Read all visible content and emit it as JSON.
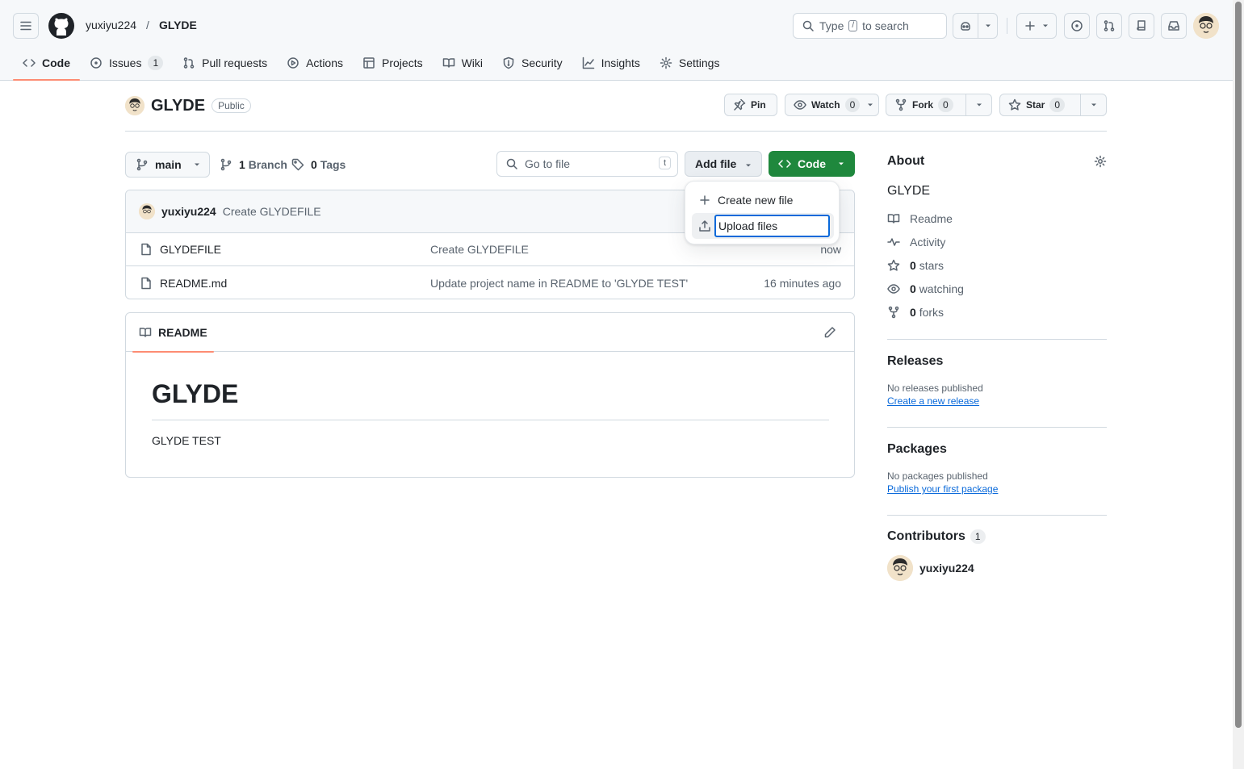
{
  "header": {
    "owner": "yuxiyu224",
    "separator": "/",
    "repo": "GLYDE",
    "search": {
      "prefix": "Type",
      "key": "/",
      "suffix": "to search"
    }
  },
  "tabs": [
    {
      "label": "Code",
      "icon": "code-icon",
      "active": true
    },
    {
      "label": "Issues",
      "icon": "issue-opened-icon",
      "count": "1"
    },
    {
      "label": "Pull requests",
      "icon": "git-pull-request-icon"
    },
    {
      "label": "Actions",
      "icon": "play-icon"
    },
    {
      "label": "Projects",
      "icon": "table-icon"
    },
    {
      "label": "Wiki",
      "icon": "book-icon"
    },
    {
      "label": "Security",
      "icon": "shield-icon"
    },
    {
      "label": "Insights",
      "icon": "graph-icon"
    },
    {
      "label": "Settings",
      "icon": "gear-icon"
    }
  ],
  "repohead": {
    "name": "GLYDE",
    "visibility": "Public",
    "pin_label": "Pin",
    "watch_label": "Watch",
    "watch_count": "0",
    "fork_label": "Fork",
    "fork_count": "0",
    "star_label": "Star",
    "star_count": "0"
  },
  "toolbar": {
    "branch": "main",
    "branches_count": "1",
    "branches_label": "Branch",
    "tags_count": "0",
    "tags_label": "Tags",
    "goto_placeholder": "Go to file",
    "goto_key": "t",
    "add_file_label": "Add file",
    "code_label": "Code"
  },
  "add_file_menu": {
    "items": [
      {
        "label": "Create new file",
        "icon": "plus-icon"
      },
      {
        "label": "Upload files",
        "icon": "upload-icon",
        "focused": true
      }
    ]
  },
  "commit": {
    "author": "yuxiyu224",
    "message": "Create GLYDEFILE"
  },
  "files": [
    {
      "name": "GLYDEFILE",
      "message": "Create GLYDEFILE",
      "date": "now"
    },
    {
      "name": "README.md",
      "message": "Update project name in README to 'GLYDE TEST'",
      "date": "16 minutes ago"
    }
  ],
  "readme": {
    "tab_label": "README",
    "heading": "GLYDE",
    "body": "GLYDE TEST"
  },
  "about": {
    "title": "About",
    "description": "GLYDE",
    "readme_label": "Readme",
    "activity_label": "Activity",
    "stars_count": "0",
    "stars_label": "stars",
    "watching_count": "0",
    "watching_label": "watching",
    "forks_count": "0",
    "forks_label": "forks"
  },
  "releases": {
    "title": "Releases",
    "empty_text": "No releases published",
    "link": "Create a new release"
  },
  "packages": {
    "title": "Packages",
    "empty_text": "No packages published",
    "link": "Publish your first package"
  },
  "contributors": {
    "title": "Contributors",
    "count": "1",
    "user": "yuxiyu224"
  },
  "colors": {
    "accent_green": "#1f883d",
    "link_blue": "#0969da",
    "tab_underline": "#fd8c73"
  }
}
